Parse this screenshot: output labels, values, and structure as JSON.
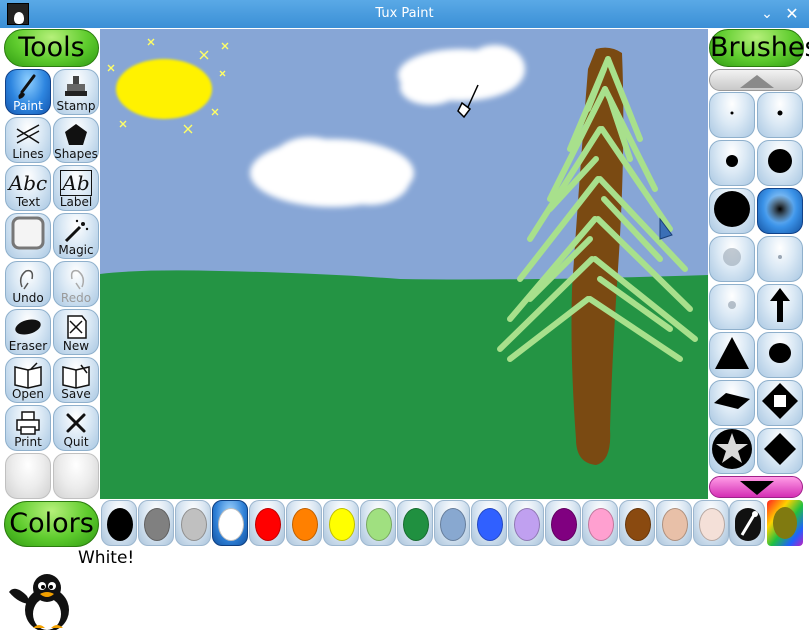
{
  "window": {
    "title": "Tux Paint",
    "minimize_icon": "chevron-down-icon",
    "close_icon": "close-icon"
  },
  "tools_header": "Tools",
  "tools": [
    {
      "id": "paint",
      "label": "Paint",
      "icon": "paintbrush-icon",
      "active": true,
      "disabled": false
    },
    {
      "id": "stamp",
      "label": "Stamp",
      "icon": "stamp-icon",
      "active": false,
      "disabled": false
    },
    {
      "id": "lines",
      "label": "Lines",
      "icon": "lines-icon",
      "active": false,
      "disabled": false
    },
    {
      "id": "shapes",
      "label": "Shapes",
      "icon": "pentagon-icon",
      "active": false,
      "disabled": false
    },
    {
      "id": "text",
      "label": "Text",
      "icon": "text-icon",
      "active": false,
      "disabled": false
    },
    {
      "id": "label",
      "label": "Label",
      "icon": "label-icon",
      "active": false,
      "disabled": false
    },
    {
      "id": "fill",
      "label": "",
      "icon": "fill-icon",
      "active": false,
      "disabled": false
    },
    {
      "id": "magic",
      "label": "Magic",
      "icon": "magic-wand-icon",
      "active": false,
      "disabled": false
    },
    {
      "id": "undo",
      "label": "Undo",
      "icon": "undo-icon",
      "active": false,
      "disabled": false
    },
    {
      "id": "redo",
      "label": "Redo",
      "icon": "redo-icon",
      "active": false,
      "disabled": true
    },
    {
      "id": "eraser",
      "label": "Eraser",
      "icon": "eraser-icon",
      "active": false,
      "disabled": false
    },
    {
      "id": "new",
      "label": "New",
      "icon": "new-page-icon",
      "active": false,
      "disabled": false
    },
    {
      "id": "open",
      "label": "Open",
      "icon": "open-book-icon",
      "active": false,
      "disabled": false
    },
    {
      "id": "save",
      "label": "Save",
      "icon": "save-icon",
      "active": false,
      "disabled": false
    },
    {
      "id": "print",
      "label": "Print",
      "icon": "printer-icon",
      "active": false,
      "disabled": false
    },
    {
      "id": "quit",
      "label": "Quit",
      "icon": "quit-icon",
      "active": false,
      "disabled": false
    }
  ],
  "brushes_header": "Brushes",
  "brushes": [
    {
      "id": "tiny-dot",
      "icon": "dot-tiny-icon",
      "active": false
    },
    {
      "id": "small-dot",
      "icon": "dot-small-icon",
      "active": false
    },
    {
      "id": "medium-dot",
      "icon": "dot-medium-icon",
      "active": false
    },
    {
      "id": "large-dot",
      "icon": "dot-large-icon",
      "active": false
    },
    {
      "id": "xlarge-dot",
      "icon": "dot-xlarge-icon",
      "active": false
    },
    {
      "id": "fuzzy-dot",
      "icon": "fuzzy-dot-icon",
      "active": true
    },
    {
      "id": "faint-dot",
      "icon": "faint-dot-icon",
      "active": false
    },
    {
      "id": "faint-small-dot",
      "icon": "faint-small-dot-icon",
      "active": false
    },
    {
      "id": "faint-tiny-dot",
      "icon": "faint-tiny-dot-icon",
      "active": false
    },
    {
      "id": "arrow-up",
      "icon": "arrow-up-icon",
      "active": false
    },
    {
      "id": "triangle",
      "icon": "triangle-icon",
      "active": false
    },
    {
      "id": "blob",
      "icon": "blob-icon",
      "active": false
    },
    {
      "id": "diamond-flat",
      "icon": "diamond-flat-icon",
      "active": false
    },
    {
      "id": "diamond-hollow",
      "icon": "diamond-hollow-icon",
      "active": false
    },
    {
      "id": "star",
      "icon": "star-icon",
      "active": false
    },
    {
      "id": "diamond",
      "icon": "diamond-icon",
      "active": false
    }
  ],
  "colors_header": "Colors",
  "colors": [
    {
      "name": "Black",
      "hex": "#000000"
    },
    {
      "name": "Gray",
      "hex": "#808080"
    },
    {
      "name": "Silver",
      "hex": "#c0c0c0"
    },
    {
      "name": "White",
      "hex": "#ffffff",
      "active": true
    },
    {
      "name": "Red",
      "hex": "#ff0000"
    },
    {
      "name": "Orange",
      "hex": "#ff8000"
    },
    {
      "name": "Yellow",
      "hex": "#ffff00"
    },
    {
      "name": "Light Green",
      "hex": "#a0e080"
    },
    {
      "name": "Green",
      "hex": "#209040"
    },
    {
      "name": "Light Blue",
      "hex": "#88a8d0"
    },
    {
      "name": "Blue",
      "hex": "#3060ff"
    },
    {
      "name": "Lavender",
      "hex": "#c0a0f0"
    },
    {
      "name": "Purple",
      "hex": "#800080"
    },
    {
      "name": "Pink",
      "hex": "#ffa0d0"
    },
    {
      "name": "Brown",
      "hex": "#8a4a10"
    },
    {
      "name": "Tan",
      "hex": "#e8c0a8"
    },
    {
      "name": "Ivory",
      "hex": "#f4e0d8"
    }
  ],
  "color_picker_icon": "eyedropper-icon",
  "color_wheel_icon": "rainbow-palette-icon",
  "status_text": "White!",
  "mascot_icon": "tux-penguin-icon",
  "palette": {
    "sky": "#87a6d6",
    "grass": "#249444",
    "sun": "#fff200",
    "trunk": "#7a4a12",
    "needles": "#a8e08c"
  }
}
